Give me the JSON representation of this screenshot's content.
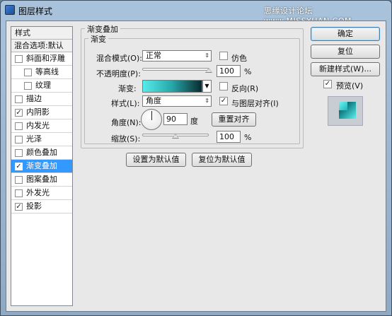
{
  "window": {
    "title": "图层样式",
    "watermark": "思缘设计论坛 www.MISSYUAN.COM"
  },
  "style_list": {
    "header": "样式",
    "blend_options": "混合选项:默认",
    "items": [
      {
        "label": "斜面和浮雕",
        "checked": false,
        "indent": false,
        "selected": false
      },
      {
        "label": "等高线",
        "checked": false,
        "indent": true,
        "selected": false
      },
      {
        "label": "纹理",
        "checked": false,
        "indent": true,
        "selected": false
      },
      {
        "label": "描边",
        "checked": false,
        "indent": false,
        "selected": false
      },
      {
        "label": "内阴影",
        "checked": true,
        "indent": false,
        "selected": false
      },
      {
        "label": "内发光",
        "checked": false,
        "indent": false,
        "selected": false
      },
      {
        "label": "光泽",
        "checked": false,
        "indent": false,
        "selected": false
      },
      {
        "label": "颜色叠加",
        "checked": false,
        "indent": false,
        "selected": false
      },
      {
        "label": "渐变叠加",
        "checked": true,
        "indent": false,
        "selected": true
      },
      {
        "label": "图案叠加",
        "checked": false,
        "indent": false,
        "selected": false
      },
      {
        "label": "外发光",
        "checked": false,
        "indent": false,
        "selected": false
      },
      {
        "label": "投影",
        "checked": true,
        "indent": false,
        "selected": false
      }
    ]
  },
  "gradient_overlay": {
    "group_title": "渐变叠加",
    "subgroup_title": "渐变",
    "blend_mode_label": "混合模式(O):",
    "blend_mode_value": "正常",
    "dither_label": "仿色",
    "dither_checked": false,
    "opacity_label": "不透明度(P):",
    "opacity_value": "100",
    "opacity_fraction": 1.0,
    "percent_unit": "%",
    "gradient_label": "渐变:",
    "gradient_colors": [
      "#57ecec",
      "#26a6a8",
      "#0a2a2e"
    ],
    "reverse_label": "反向(R)",
    "reverse_checked": false,
    "style_label": "样式(L):",
    "style_value": "角度",
    "align_label": "与图层对齐(I)",
    "align_checked": true,
    "angle_label": "角度(N):",
    "angle_value": "90",
    "angle_unit": "度",
    "reset_align_label": "重置对齐",
    "scale_label": "缩放(S):",
    "scale_value": "100",
    "scale_fraction": 0.5,
    "set_default_label": "设置为默认值",
    "reset_default_label": "复位为默认值"
  },
  "actions": {
    "ok_label": "确定",
    "reset_label": "复位",
    "new_style_label": "新建样式(W)...",
    "preview_label": "预览(V)",
    "preview_checked": true
  }
}
